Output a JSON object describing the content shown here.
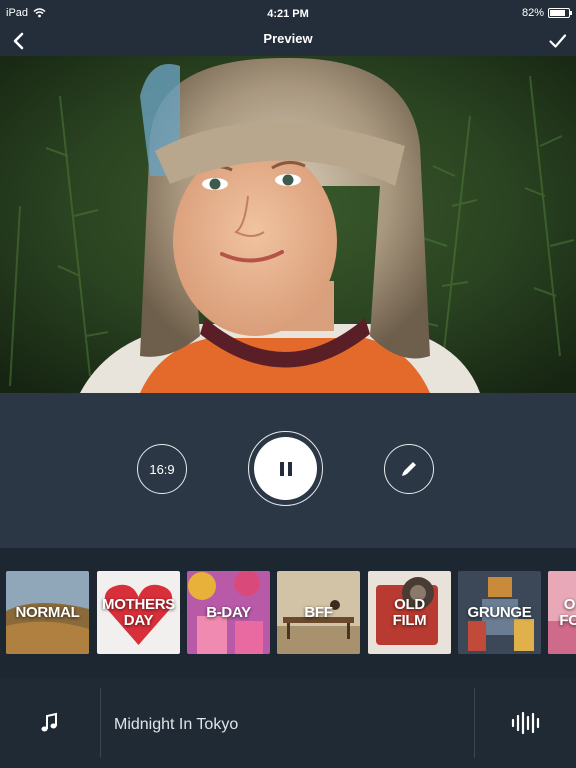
{
  "status": {
    "device": "iPad",
    "time": "4:21 PM",
    "battery": "82%",
    "battery_level": 0.82
  },
  "nav": {
    "title": "Preview",
    "back_icon": "chevron-left-icon",
    "done_icon": "checkmark-icon"
  },
  "player": {
    "aspect_label": "16:9",
    "state": "playing",
    "play_icon": "pause-icon",
    "edit_icon": "pencil-icon"
  },
  "themes": [
    {
      "label": "NORMAL",
      "lines": [
        "NORMAL"
      ]
    },
    {
      "label": "MOTHERS DAY",
      "lines": [
        "MOTHERS",
        "DAY"
      ]
    },
    {
      "label": "B-DAY",
      "lines": [
        "B-DAY"
      ]
    },
    {
      "label": "BFF",
      "lines": [
        "BFF"
      ]
    },
    {
      "label": "OLD FILM",
      "lines": [
        "OLD",
        "FILM"
      ]
    },
    {
      "label": "GRUNGE",
      "lines": [
        "GRUNGE"
      ]
    },
    {
      "label": "",
      "lines": [
        "O",
        "FO"
      ]
    }
  ],
  "music": {
    "track": "Midnight In Tokyo",
    "music_icon": "music-note-icon",
    "waveform_icon": "waveform-icon"
  },
  "colors": {
    "background": "#242f3b",
    "bar": "#1f2a35",
    "accent": "#ffffff"
  }
}
